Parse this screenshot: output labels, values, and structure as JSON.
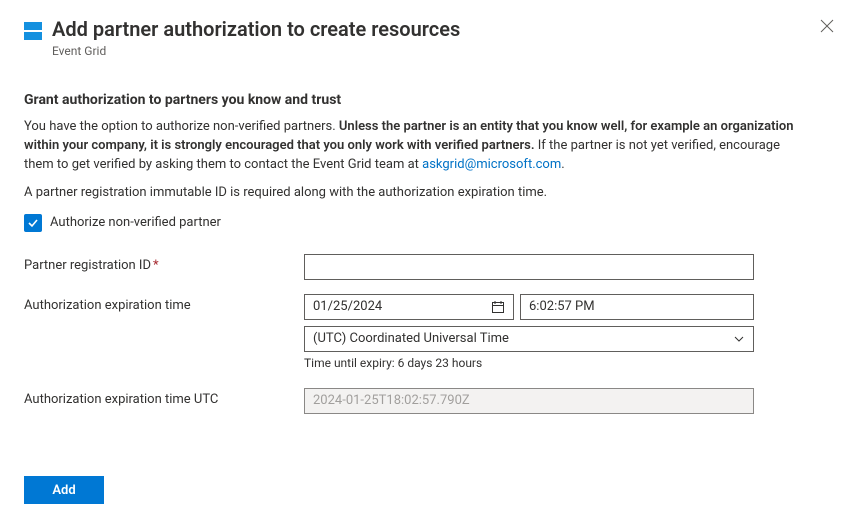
{
  "header": {
    "title": "Add partner authorization to create resources",
    "subtitle": "Event Grid"
  },
  "section_heading": "Grant authorization to partners you know and trust",
  "intro": {
    "pre": "You have the option to authorize non-verified partners. ",
    "bold": "Unless the partner is an entity that you know well, for example an organization within your company, it is strongly encouraged that you only work with verified partners.",
    "mid": " If the partner is not yet verified, encourage them to get verified by asking them to contact the Event Grid team at ",
    "link": "askgrid@microsoft.com",
    "post": ".",
    "line2": "A partner registration immutable ID is required along with the authorization expiration time."
  },
  "checkbox": {
    "label": "Authorize non-verified partner",
    "checked": true
  },
  "fields": {
    "registration_id": {
      "label": "Partner registration ID",
      "required": "*",
      "value": ""
    },
    "expiration": {
      "label": "Authorization expiration time",
      "date": "01/25/2024",
      "time": "6:02:57 PM",
      "timezone": "(UTC) Coordinated Universal Time",
      "helper": "Time until expiry: 6 days 23 hours"
    },
    "expiration_utc": {
      "label": "Authorization expiration time UTC",
      "value": "2024-01-25T18:02:57.790Z"
    }
  },
  "footer": {
    "add_label": "Add"
  }
}
